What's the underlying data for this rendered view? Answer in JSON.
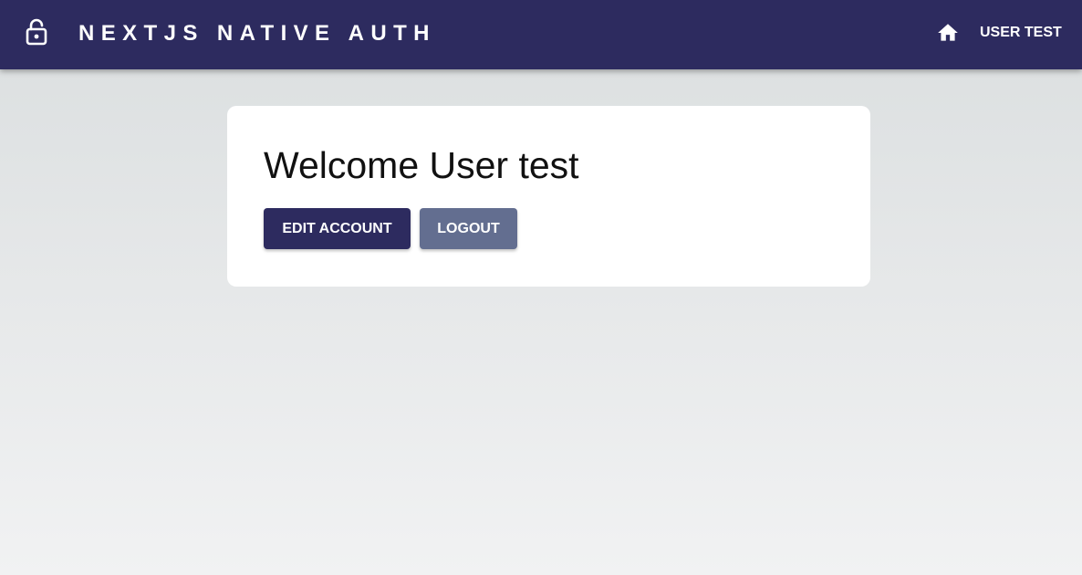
{
  "appbar": {
    "title": "NEXTJS NATIVE AUTH",
    "lock_icon": "unlocked-padlock-icon",
    "home_icon": "home-icon",
    "user_label": "USER TEST",
    "background_color": "#2d2b5f"
  },
  "main": {
    "welcome_text": "Welcome User test",
    "edit_account_label": "EDIT ACCOUNT",
    "logout_label": "LOGOUT",
    "edit_button_color": "#2d2b5f",
    "logout_button_color": "#636e90"
  }
}
